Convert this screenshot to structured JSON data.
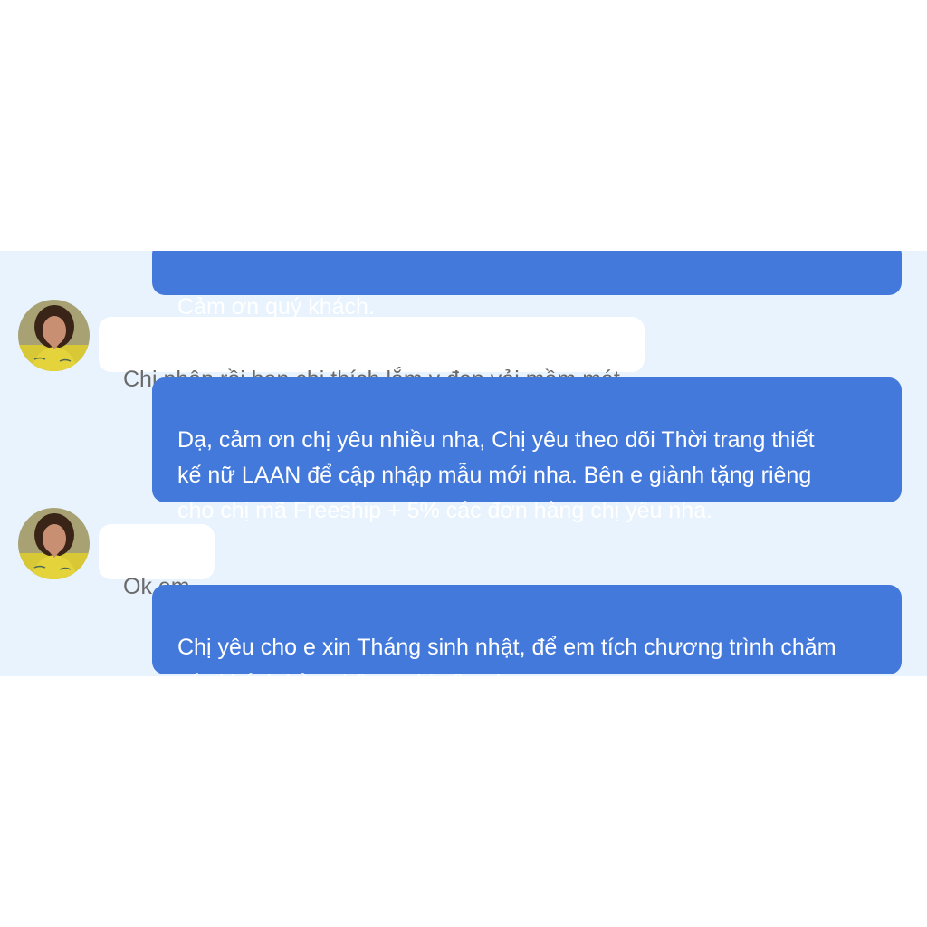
{
  "conversation": {
    "messages": [
      {
        "sender": "shop",
        "text": "Cảm ơn quý khách."
      },
      {
        "sender": "customer",
        "text": "Chị nhận rồi bạn chị thích lắm y đẹp vải mềm mát"
      },
      {
        "sender": "shop",
        "text": "Dạ, cảm ơn chị yêu nhiều nha, Chị yêu theo dõi Thời trang thiết\nkế nữ LAAN để cập nhập mẫu mới nha. Bên e giành tặng riêng\ncho chị mã Freeship + 5% các đơn hàng chị yêu nha."
      },
      {
        "sender": "customer",
        "text": "Ok em"
      },
      {
        "sender": "shop",
        "text": "Chị yêu cho e xin Tháng sinh nhật, để em tích chương trình chăm\nsóc khách hàng bên e chị yêu nha"
      }
    ]
  },
  "colors": {
    "panel_background": "#e8f3fd",
    "outgoing_bubble": "#4479dc",
    "incoming_bubble": "#ffffff",
    "incoming_text": "#6a6a6a"
  },
  "icons": {
    "customer_avatar": "avatar-photo"
  }
}
